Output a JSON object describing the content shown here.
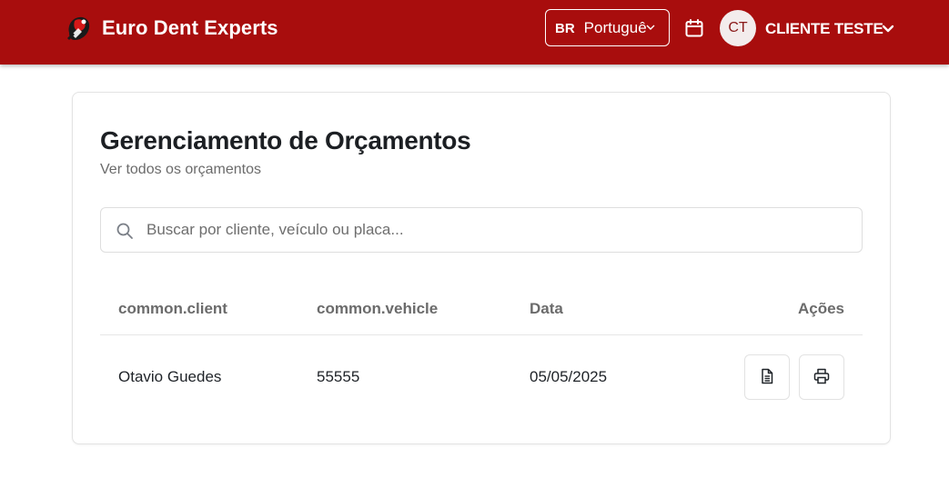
{
  "header": {
    "brand_name": "Euro Dent Experts",
    "language": {
      "flag": "BR",
      "label": "Português"
    },
    "user": {
      "initials": "CT",
      "name": "CLIENTE TESTE"
    }
  },
  "main": {
    "title": "Gerenciamento de Orçamentos",
    "subtitle": "Ver todos os orçamentos",
    "search": {
      "placeholder": "Buscar por cliente, veículo ou placa...",
      "value": ""
    },
    "table": {
      "columns": {
        "client": "common.client",
        "vehicle": "common.vehicle",
        "date": "Data",
        "actions": "Ações"
      },
      "rows": [
        {
          "client": "Otavio Guedes",
          "vehicle": "55555",
          "date": "05/05/2025"
        }
      ]
    }
  },
  "colors": {
    "brand": "#a80d0d",
    "text": "#1f2328",
    "muted": "#6b6b6b"
  },
  "icons": [
    "logo-icon",
    "chevron-down-icon",
    "calendar-icon",
    "search-icon",
    "document-icon",
    "printer-icon"
  ]
}
